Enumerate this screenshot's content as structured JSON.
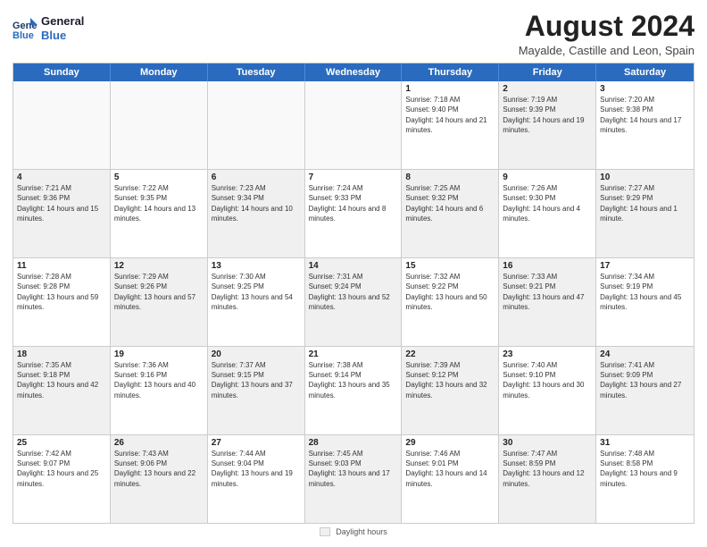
{
  "header": {
    "logo_line1": "General",
    "logo_line2": "Blue",
    "month": "August 2024",
    "location": "Mayalde, Castille and Leon, Spain"
  },
  "days_of_week": [
    "Sunday",
    "Monday",
    "Tuesday",
    "Wednesday",
    "Thursday",
    "Friday",
    "Saturday"
  ],
  "legend_label": "Daylight hours",
  "rows": [
    [
      {
        "day": "",
        "empty": true
      },
      {
        "day": "",
        "empty": true
      },
      {
        "day": "",
        "empty": true
      },
      {
        "day": "",
        "empty": true
      },
      {
        "day": "1",
        "sunrise": "7:18 AM",
        "sunset": "9:40 PM",
        "daylight": "14 hours and 21 minutes.",
        "shaded": false
      },
      {
        "day": "2",
        "sunrise": "7:19 AM",
        "sunset": "9:39 PM",
        "daylight": "14 hours and 19 minutes.",
        "shaded": true
      },
      {
        "day": "3",
        "sunrise": "7:20 AM",
        "sunset": "9:38 PM",
        "daylight": "14 hours and 17 minutes.",
        "shaded": false
      }
    ],
    [
      {
        "day": "4",
        "sunrise": "7:21 AM",
        "sunset": "9:36 PM",
        "daylight": "14 hours and 15 minutes.",
        "shaded": true
      },
      {
        "day": "5",
        "sunrise": "7:22 AM",
        "sunset": "9:35 PM",
        "daylight": "14 hours and 13 minutes.",
        "shaded": false
      },
      {
        "day": "6",
        "sunrise": "7:23 AM",
        "sunset": "9:34 PM",
        "daylight": "14 hours and 10 minutes.",
        "shaded": true
      },
      {
        "day": "7",
        "sunrise": "7:24 AM",
        "sunset": "9:33 PM",
        "daylight": "14 hours and 8 minutes.",
        "shaded": false
      },
      {
        "day": "8",
        "sunrise": "7:25 AM",
        "sunset": "9:32 PM",
        "daylight": "14 hours and 6 minutes.",
        "shaded": true
      },
      {
        "day": "9",
        "sunrise": "7:26 AM",
        "sunset": "9:30 PM",
        "daylight": "14 hours and 4 minutes.",
        "shaded": false
      },
      {
        "day": "10",
        "sunrise": "7:27 AM",
        "sunset": "9:29 PM",
        "daylight": "14 hours and 1 minute.",
        "shaded": true
      }
    ],
    [
      {
        "day": "11",
        "sunrise": "7:28 AM",
        "sunset": "9:28 PM",
        "daylight": "13 hours and 59 minutes.",
        "shaded": false
      },
      {
        "day": "12",
        "sunrise": "7:29 AM",
        "sunset": "9:26 PM",
        "daylight": "13 hours and 57 minutes.",
        "shaded": true
      },
      {
        "day": "13",
        "sunrise": "7:30 AM",
        "sunset": "9:25 PM",
        "daylight": "13 hours and 54 minutes.",
        "shaded": false
      },
      {
        "day": "14",
        "sunrise": "7:31 AM",
        "sunset": "9:24 PM",
        "daylight": "13 hours and 52 minutes.",
        "shaded": true
      },
      {
        "day": "15",
        "sunrise": "7:32 AM",
        "sunset": "9:22 PM",
        "daylight": "13 hours and 50 minutes.",
        "shaded": false
      },
      {
        "day": "16",
        "sunrise": "7:33 AM",
        "sunset": "9:21 PM",
        "daylight": "13 hours and 47 minutes.",
        "shaded": true
      },
      {
        "day": "17",
        "sunrise": "7:34 AM",
        "sunset": "9:19 PM",
        "daylight": "13 hours and 45 minutes.",
        "shaded": false
      }
    ],
    [
      {
        "day": "18",
        "sunrise": "7:35 AM",
        "sunset": "9:18 PM",
        "daylight": "13 hours and 42 minutes.",
        "shaded": true
      },
      {
        "day": "19",
        "sunrise": "7:36 AM",
        "sunset": "9:16 PM",
        "daylight": "13 hours and 40 minutes.",
        "shaded": false
      },
      {
        "day": "20",
        "sunrise": "7:37 AM",
        "sunset": "9:15 PM",
        "daylight": "13 hours and 37 minutes.",
        "shaded": true
      },
      {
        "day": "21",
        "sunrise": "7:38 AM",
        "sunset": "9:14 PM",
        "daylight": "13 hours and 35 minutes.",
        "shaded": false
      },
      {
        "day": "22",
        "sunrise": "7:39 AM",
        "sunset": "9:12 PM",
        "daylight": "13 hours and 32 minutes.",
        "shaded": true
      },
      {
        "day": "23",
        "sunrise": "7:40 AM",
        "sunset": "9:10 PM",
        "daylight": "13 hours and 30 minutes.",
        "shaded": false
      },
      {
        "day": "24",
        "sunrise": "7:41 AM",
        "sunset": "9:09 PM",
        "daylight": "13 hours and 27 minutes.",
        "shaded": true
      }
    ],
    [
      {
        "day": "25",
        "sunrise": "7:42 AM",
        "sunset": "9:07 PM",
        "daylight": "13 hours and 25 minutes.",
        "shaded": false
      },
      {
        "day": "26",
        "sunrise": "7:43 AM",
        "sunset": "9:06 PM",
        "daylight": "13 hours and 22 minutes.",
        "shaded": true
      },
      {
        "day": "27",
        "sunrise": "7:44 AM",
        "sunset": "9:04 PM",
        "daylight": "13 hours and 19 minutes.",
        "shaded": false
      },
      {
        "day": "28",
        "sunrise": "7:45 AM",
        "sunset": "9:03 PM",
        "daylight": "13 hours and 17 minutes.",
        "shaded": true
      },
      {
        "day": "29",
        "sunrise": "7:46 AM",
        "sunset": "9:01 PM",
        "daylight": "13 hours and 14 minutes.",
        "shaded": false
      },
      {
        "day": "30",
        "sunrise": "7:47 AM",
        "sunset": "8:59 PM",
        "daylight": "13 hours and 12 minutes.",
        "shaded": true
      },
      {
        "day": "31",
        "sunrise": "7:48 AM",
        "sunset": "8:58 PM",
        "daylight": "13 hours and 9 minutes.",
        "shaded": false
      }
    ]
  ]
}
